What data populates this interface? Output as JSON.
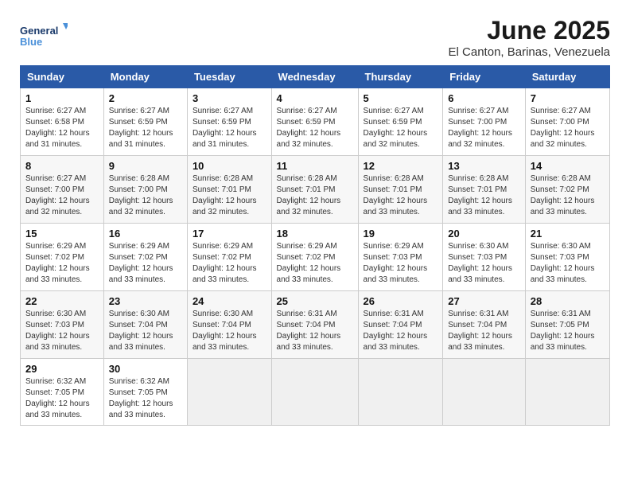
{
  "header": {
    "logo_line1": "General",
    "logo_line2": "Blue",
    "month_title": "June 2025",
    "location": "El Canton, Barinas, Venezuela"
  },
  "days_of_week": [
    "Sunday",
    "Monday",
    "Tuesday",
    "Wednesday",
    "Thursday",
    "Friday",
    "Saturday"
  ],
  "weeks": [
    [
      {
        "day": 1,
        "sunrise": "6:27 AM",
        "sunset": "6:58 PM",
        "daylight": "12 hours and 31 minutes."
      },
      {
        "day": 2,
        "sunrise": "6:27 AM",
        "sunset": "6:59 PM",
        "daylight": "12 hours and 31 minutes."
      },
      {
        "day": 3,
        "sunrise": "6:27 AM",
        "sunset": "6:59 PM",
        "daylight": "12 hours and 31 minutes."
      },
      {
        "day": 4,
        "sunrise": "6:27 AM",
        "sunset": "6:59 PM",
        "daylight": "12 hours and 32 minutes."
      },
      {
        "day": 5,
        "sunrise": "6:27 AM",
        "sunset": "6:59 PM",
        "daylight": "12 hours and 32 minutes."
      },
      {
        "day": 6,
        "sunrise": "6:27 AM",
        "sunset": "7:00 PM",
        "daylight": "12 hours and 32 minutes."
      },
      {
        "day": 7,
        "sunrise": "6:27 AM",
        "sunset": "7:00 PM",
        "daylight": "12 hours and 32 minutes."
      }
    ],
    [
      {
        "day": 8,
        "sunrise": "6:27 AM",
        "sunset": "7:00 PM",
        "daylight": "12 hours and 32 minutes."
      },
      {
        "day": 9,
        "sunrise": "6:28 AM",
        "sunset": "7:00 PM",
        "daylight": "12 hours and 32 minutes."
      },
      {
        "day": 10,
        "sunrise": "6:28 AM",
        "sunset": "7:01 PM",
        "daylight": "12 hours and 32 minutes."
      },
      {
        "day": 11,
        "sunrise": "6:28 AM",
        "sunset": "7:01 PM",
        "daylight": "12 hours and 32 minutes."
      },
      {
        "day": 12,
        "sunrise": "6:28 AM",
        "sunset": "7:01 PM",
        "daylight": "12 hours and 33 minutes."
      },
      {
        "day": 13,
        "sunrise": "6:28 AM",
        "sunset": "7:01 PM",
        "daylight": "12 hours and 33 minutes."
      },
      {
        "day": 14,
        "sunrise": "6:28 AM",
        "sunset": "7:02 PM",
        "daylight": "12 hours and 33 minutes."
      }
    ],
    [
      {
        "day": 15,
        "sunrise": "6:29 AM",
        "sunset": "7:02 PM",
        "daylight": "12 hours and 33 minutes."
      },
      {
        "day": 16,
        "sunrise": "6:29 AM",
        "sunset": "7:02 PM",
        "daylight": "12 hours and 33 minutes."
      },
      {
        "day": 17,
        "sunrise": "6:29 AM",
        "sunset": "7:02 PM",
        "daylight": "12 hours and 33 minutes."
      },
      {
        "day": 18,
        "sunrise": "6:29 AM",
        "sunset": "7:02 PM",
        "daylight": "12 hours and 33 minutes."
      },
      {
        "day": 19,
        "sunrise": "6:29 AM",
        "sunset": "7:03 PM",
        "daylight": "12 hours and 33 minutes."
      },
      {
        "day": 20,
        "sunrise": "6:30 AM",
        "sunset": "7:03 PM",
        "daylight": "12 hours and 33 minutes."
      },
      {
        "day": 21,
        "sunrise": "6:30 AM",
        "sunset": "7:03 PM",
        "daylight": "12 hours and 33 minutes."
      }
    ],
    [
      {
        "day": 22,
        "sunrise": "6:30 AM",
        "sunset": "7:03 PM",
        "daylight": "12 hours and 33 minutes."
      },
      {
        "day": 23,
        "sunrise": "6:30 AM",
        "sunset": "7:04 PM",
        "daylight": "12 hours and 33 minutes."
      },
      {
        "day": 24,
        "sunrise": "6:30 AM",
        "sunset": "7:04 PM",
        "daylight": "12 hours and 33 minutes."
      },
      {
        "day": 25,
        "sunrise": "6:31 AM",
        "sunset": "7:04 PM",
        "daylight": "12 hours and 33 minutes."
      },
      {
        "day": 26,
        "sunrise": "6:31 AM",
        "sunset": "7:04 PM",
        "daylight": "12 hours and 33 minutes."
      },
      {
        "day": 27,
        "sunrise": "6:31 AM",
        "sunset": "7:04 PM",
        "daylight": "12 hours and 33 minutes."
      },
      {
        "day": 28,
        "sunrise": "6:31 AM",
        "sunset": "7:05 PM",
        "daylight": "12 hours and 33 minutes."
      }
    ],
    [
      {
        "day": 29,
        "sunrise": "6:32 AM",
        "sunset": "7:05 PM",
        "daylight": "12 hours and 33 minutes."
      },
      {
        "day": 30,
        "sunrise": "6:32 AM",
        "sunset": "7:05 PM",
        "daylight": "12 hours and 33 minutes."
      },
      null,
      null,
      null,
      null,
      null
    ]
  ],
  "labels": {
    "sunrise": "Sunrise:",
    "sunset": "Sunset:",
    "daylight": "Daylight:"
  }
}
